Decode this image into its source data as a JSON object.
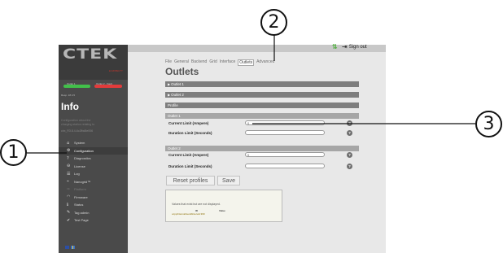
{
  "sidebar": {
    "logo": "CTEK",
    "logo_sub": "E-MOBILITY",
    "led1_label": "Outlet 1",
    "led2_label": "Outlet 2 · Fault",
    "fw_text": "Resp. 18.4.5",
    "info_title": "Info",
    "info_desc_1": "Configuration about the",
    "info_desc_2": "charging station relating to",
    "serial": "cbx_R3.8.4-6c2fbd8e006",
    "menu": [
      {
        "label": "System",
        "icon": "home-icon"
      },
      {
        "label": "Configuration",
        "icon": "gear-icon"
      },
      {
        "label": "Diagnostics",
        "icon": "question-icon"
      },
      {
        "label": "License",
        "icon": "lock-icon"
      },
      {
        "label": "Log",
        "icon": "list-icon"
      },
      {
        "label": "Nanogrid™",
        "icon": "signal-icon"
      },
      {
        "label": "Platform",
        "icon": "wrench-icon"
      },
      {
        "label": "Firmware",
        "icon": "wifi-icon"
      },
      {
        "label": "Status",
        "icon": "info-icon"
      },
      {
        "label": "Tag admin",
        "icon": "pen-icon"
      },
      {
        "label": "Test Page",
        "icon": "check-icon"
      }
    ]
  },
  "header": {
    "signout": "Sign out"
  },
  "tabs": [
    {
      "label": "File"
    },
    {
      "label": "General"
    },
    {
      "label": "Backend"
    },
    {
      "label": "Grid"
    },
    {
      "label": "Interface"
    },
    {
      "label": "Outlets"
    },
    {
      "label": "Advanced"
    }
  ],
  "main": {
    "title": "Outlets",
    "outlet1_bar": "Outlet 1",
    "outlet2_bar": "Outlet 2",
    "profile_bar": "Profile",
    "profile_outlet1": "Outlet 1",
    "profile_outlet2": "Outlet 2",
    "current_limit_label": "Current Limit (Ampere)",
    "duration_limit_label": "Duration Limit (Seconds)",
    "outlet1_current_value": "0",
    "outlet1_duration_value": "",
    "outlet2_current_value": "0",
    "outlet2_duration_value": "",
    "reset_button": "Reset profiles",
    "save_button": "Save"
  },
  "note": {
    "text": "Values that exist but are not displayed.",
    "col_id": "ID",
    "col_value": "Value",
    "row": "ocpp/interval/sendlinterval 360"
  },
  "callouts": [
    "1",
    "2",
    "3"
  ]
}
